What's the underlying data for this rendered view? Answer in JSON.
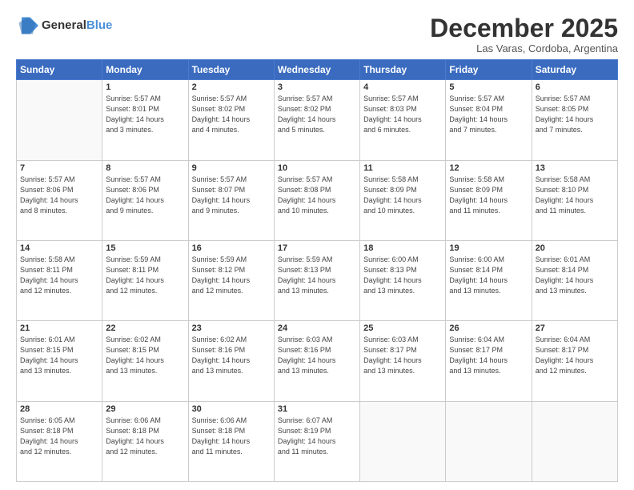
{
  "header": {
    "logo_general": "General",
    "logo_blue": "Blue",
    "title": "December 2025",
    "location": "Las Varas, Cordoba, Argentina"
  },
  "days_of_week": [
    "Sunday",
    "Monday",
    "Tuesday",
    "Wednesday",
    "Thursday",
    "Friday",
    "Saturday"
  ],
  "weeks": [
    [
      {
        "day": "",
        "info": ""
      },
      {
        "day": "1",
        "info": "Sunrise: 5:57 AM\nSunset: 8:01 PM\nDaylight: 14 hours\nand 3 minutes."
      },
      {
        "day": "2",
        "info": "Sunrise: 5:57 AM\nSunset: 8:02 PM\nDaylight: 14 hours\nand 4 minutes."
      },
      {
        "day": "3",
        "info": "Sunrise: 5:57 AM\nSunset: 8:02 PM\nDaylight: 14 hours\nand 5 minutes."
      },
      {
        "day": "4",
        "info": "Sunrise: 5:57 AM\nSunset: 8:03 PM\nDaylight: 14 hours\nand 6 minutes."
      },
      {
        "day": "5",
        "info": "Sunrise: 5:57 AM\nSunset: 8:04 PM\nDaylight: 14 hours\nand 7 minutes."
      },
      {
        "day": "6",
        "info": "Sunrise: 5:57 AM\nSunset: 8:05 PM\nDaylight: 14 hours\nand 7 minutes."
      }
    ],
    [
      {
        "day": "7",
        "info": "Sunrise: 5:57 AM\nSunset: 8:06 PM\nDaylight: 14 hours\nand 8 minutes."
      },
      {
        "day": "8",
        "info": "Sunrise: 5:57 AM\nSunset: 8:06 PM\nDaylight: 14 hours\nand 9 minutes."
      },
      {
        "day": "9",
        "info": "Sunrise: 5:57 AM\nSunset: 8:07 PM\nDaylight: 14 hours\nand 9 minutes."
      },
      {
        "day": "10",
        "info": "Sunrise: 5:57 AM\nSunset: 8:08 PM\nDaylight: 14 hours\nand 10 minutes."
      },
      {
        "day": "11",
        "info": "Sunrise: 5:58 AM\nSunset: 8:09 PM\nDaylight: 14 hours\nand 10 minutes."
      },
      {
        "day": "12",
        "info": "Sunrise: 5:58 AM\nSunset: 8:09 PM\nDaylight: 14 hours\nand 11 minutes."
      },
      {
        "day": "13",
        "info": "Sunrise: 5:58 AM\nSunset: 8:10 PM\nDaylight: 14 hours\nand 11 minutes."
      }
    ],
    [
      {
        "day": "14",
        "info": "Sunrise: 5:58 AM\nSunset: 8:11 PM\nDaylight: 14 hours\nand 12 minutes."
      },
      {
        "day": "15",
        "info": "Sunrise: 5:59 AM\nSunset: 8:11 PM\nDaylight: 14 hours\nand 12 minutes."
      },
      {
        "day": "16",
        "info": "Sunrise: 5:59 AM\nSunset: 8:12 PM\nDaylight: 14 hours\nand 12 minutes."
      },
      {
        "day": "17",
        "info": "Sunrise: 5:59 AM\nSunset: 8:13 PM\nDaylight: 14 hours\nand 13 minutes."
      },
      {
        "day": "18",
        "info": "Sunrise: 6:00 AM\nSunset: 8:13 PM\nDaylight: 14 hours\nand 13 minutes."
      },
      {
        "day": "19",
        "info": "Sunrise: 6:00 AM\nSunset: 8:14 PM\nDaylight: 14 hours\nand 13 minutes."
      },
      {
        "day": "20",
        "info": "Sunrise: 6:01 AM\nSunset: 8:14 PM\nDaylight: 14 hours\nand 13 minutes."
      }
    ],
    [
      {
        "day": "21",
        "info": "Sunrise: 6:01 AM\nSunset: 8:15 PM\nDaylight: 14 hours\nand 13 minutes."
      },
      {
        "day": "22",
        "info": "Sunrise: 6:02 AM\nSunset: 8:15 PM\nDaylight: 14 hours\nand 13 minutes."
      },
      {
        "day": "23",
        "info": "Sunrise: 6:02 AM\nSunset: 8:16 PM\nDaylight: 14 hours\nand 13 minutes."
      },
      {
        "day": "24",
        "info": "Sunrise: 6:03 AM\nSunset: 8:16 PM\nDaylight: 14 hours\nand 13 minutes."
      },
      {
        "day": "25",
        "info": "Sunrise: 6:03 AM\nSunset: 8:17 PM\nDaylight: 14 hours\nand 13 minutes."
      },
      {
        "day": "26",
        "info": "Sunrise: 6:04 AM\nSunset: 8:17 PM\nDaylight: 14 hours\nand 13 minutes."
      },
      {
        "day": "27",
        "info": "Sunrise: 6:04 AM\nSunset: 8:17 PM\nDaylight: 14 hours\nand 12 minutes."
      }
    ],
    [
      {
        "day": "28",
        "info": "Sunrise: 6:05 AM\nSunset: 8:18 PM\nDaylight: 14 hours\nand 12 minutes."
      },
      {
        "day": "29",
        "info": "Sunrise: 6:06 AM\nSunset: 8:18 PM\nDaylight: 14 hours\nand 12 minutes."
      },
      {
        "day": "30",
        "info": "Sunrise: 6:06 AM\nSunset: 8:18 PM\nDaylight: 14 hours\nand 11 minutes."
      },
      {
        "day": "31",
        "info": "Sunrise: 6:07 AM\nSunset: 8:19 PM\nDaylight: 14 hours\nand 11 minutes."
      },
      {
        "day": "",
        "info": ""
      },
      {
        "day": "",
        "info": ""
      },
      {
        "day": "",
        "info": ""
      }
    ]
  ]
}
